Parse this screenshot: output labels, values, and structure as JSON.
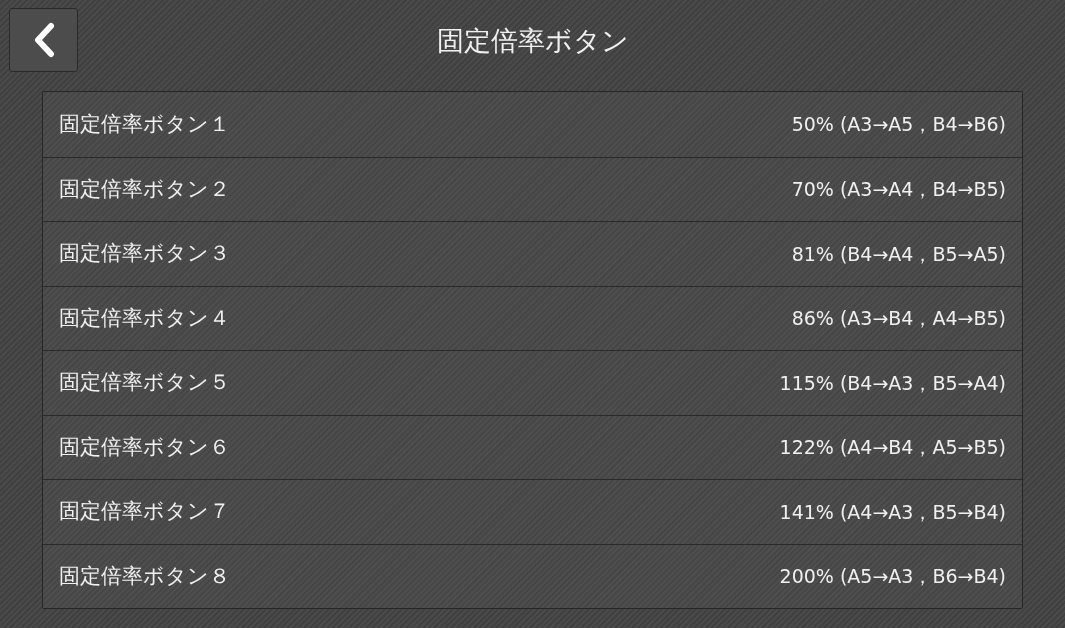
{
  "header": {
    "title": "固定倍率ボタン"
  },
  "items": [
    {
      "label": "固定倍率ボタン１",
      "value": "50% (A3→A5，B4→B6)"
    },
    {
      "label": "固定倍率ボタン２",
      "value": "70% (A3→A4，B4→B5)"
    },
    {
      "label": "固定倍率ボタン３",
      "value": "81% (B4→A4，B5→A5)"
    },
    {
      "label": "固定倍率ボタン４",
      "value": "86% (A3→B4，A4→B5)"
    },
    {
      "label": "固定倍率ボタン５",
      "value": "115% (B4→A3，B5→A4)"
    },
    {
      "label": "固定倍率ボタン６",
      "value": "122% (A4→B4，A5→B5)"
    },
    {
      "label": "固定倍率ボタン７",
      "value": "141% (A4→A3，B5→B4)"
    },
    {
      "label": "固定倍率ボタン８",
      "value": "200% (A5→A3，B6→B4)"
    }
  ]
}
